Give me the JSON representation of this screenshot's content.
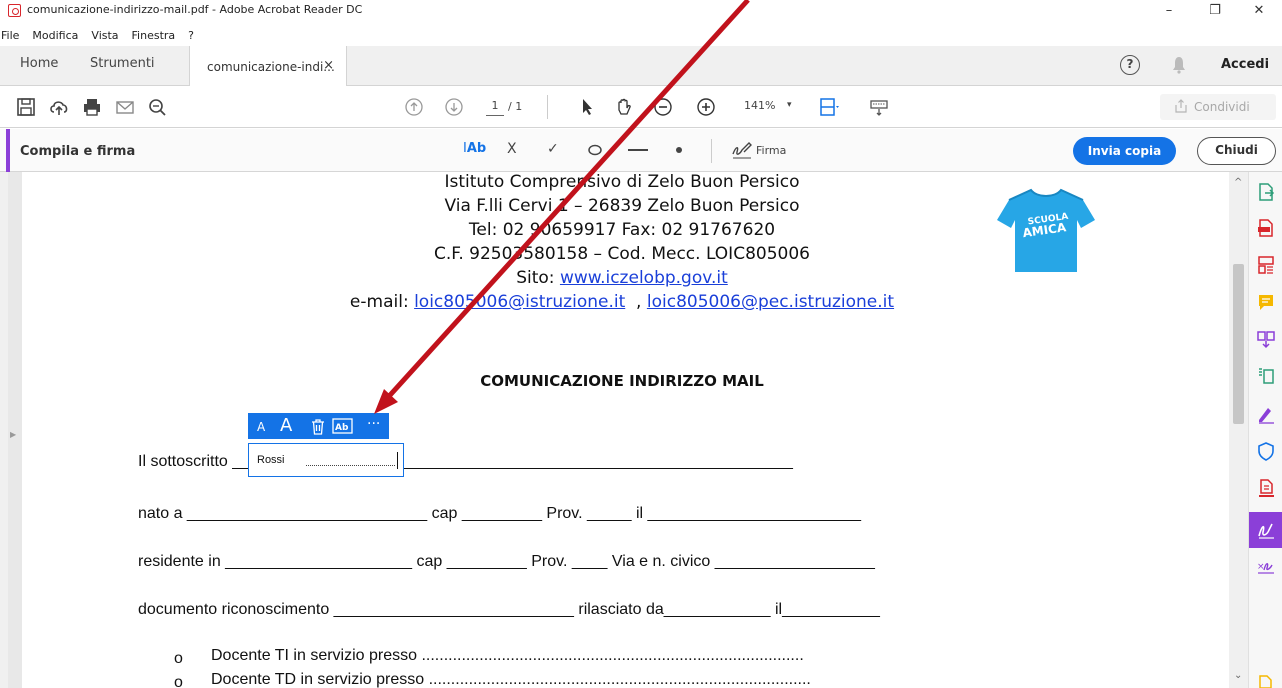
{
  "window": {
    "title": "comunicazione-indirizzo-mail.pdf - Adobe Acrobat Reader DC",
    "minimize": "–",
    "restore": "❐",
    "close": "✕"
  },
  "menu": [
    "File",
    "Modifica",
    "Vista",
    "Finestra",
    "?"
  ],
  "tabs": {
    "home": "Home",
    "tools": "Strumenti",
    "document": "comunicazione-indi...",
    "document_close": "×",
    "help": "?",
    "signin": "Accedi"
  },
  "toolbar": {
    "page_current": "1",
    "page_total": "/ 1",
    "zoom": "141%",
    "zoom_caret": "▾",
    "share": "Condividi"
  },
  "fill_sign": {
    "label": "Compila e firma",
    "text_tool": "Ab",
    "cross_tool": "X",
    "check_tool": "✓",
    "sign": "Firma",
    "send_copy": "Invia copia",
    "close": "Chiudi"
  },
  "document": {
    "header_lines": [
      "Istituto Comprensivo di Zelo Buon Persico",
      "Via F.lli Cervi 1 – 26839 Zelo Buon Persico",
      "Tel: 02 90659917 Fax: 02 91767620",
      "C.F. 92503580158 – Cod. Mecc. LOIC805006"
    ],
    "site_label": "Sito: ",
    "site_link": "www.iczelobp.gov.it",
    "email_label": "e-mail: ",
    "email1": "loic805006@istruzione.it",
    "email_sep": "  , ",
    "email2": "loic805006@pec.istruzione.it",
    "logo_text": "SCUOLA\nAMICA",
    "title": "COMUNICAZIONE INDIRIZZO MAIL",
    "form_lines": [
      "Il sottoscritto _______________________________________________________________",
      "nato a ___________________________ cap _________ Prov. _____ il ________________________",
      "residente in _____________________ cap _________ Prov. ____ Via e n. civico __________________",
      "documento riconoscimento ___________________________ rilasciato da____________ il___________"
    ],
    "bullets": [
      "Docente TI in servizio presso ......................................................................................",
      "Docente TD in servizio presso ......................................................................................"
    ],
    "bullet_marker": "o"
  },
  "field": {
    "value": "Rossi",
    "tool_small": "A",
    "tool_large": "A",
    "tool_more": "···"
  }
}
